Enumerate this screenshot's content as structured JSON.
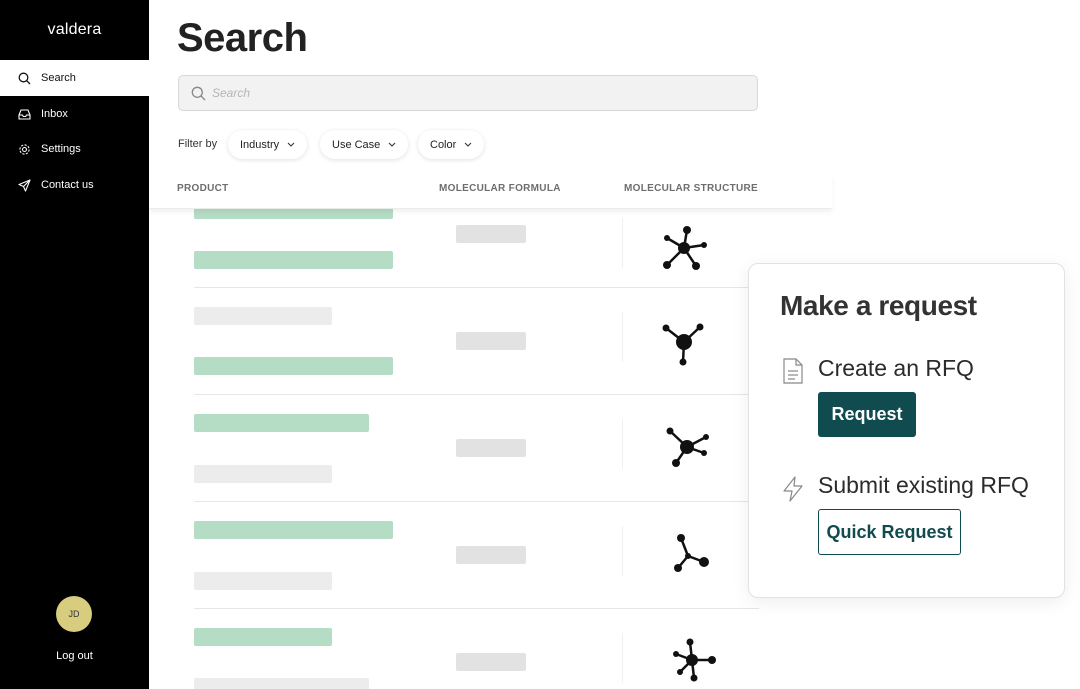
{
  "brand": {
    "name": "valdera"
  },
  "sidebar": {
    "items": [
      {
        "label": "Search",
        "icon": "search-icon",
        "active": true
      },
      {
        "label": "Inbox",
        "icon": "inbox-icon",
        "active": false
      },
      {
        "label": "Settings",
        "icon": "gear-icon",
        "active": false
      },
      {
        "label": "Contact us",
        "icon": "send-icon",
        "active": false
      }
    ],
    "avatar_initials": "JD",
    "logout_label": "Log out"
  },
  "main": {
    "title": "Search",
    "search": {
      "placeholder": "Search",
      "value": ""
    },
    "filters": {
      "label": "Filter by",
      "chips": [
        "Industry",
        "Use Case",
        "Color"
      ]
    },
    "table": {
      "columns": [
        "PRODUCT",
        "MOLECULAR FORMULA",
        "MOLECULAR STRUCTURE"
      ]
    }
  },
  "request_card": {
    "title": "Make a request",
    "options": [
      {
        "label": "Create an RFQ",
        "icon": "document-icon",
        "button": "Request"
      },
      {
        "label": "Submit existing RFQ",
        "icon": "lightning-icon",
        "button": "Quick Request"
      }
    ]
  },
  "colors": {
    "sidebar_bg": "#000000",
    "accent": "#0f4b4f",
    "skeleton_green": "#b5dcc5",
    "skeleton_gray": "#ececec",
    "avatar_bg": "#d8cc7e"
  }
}
